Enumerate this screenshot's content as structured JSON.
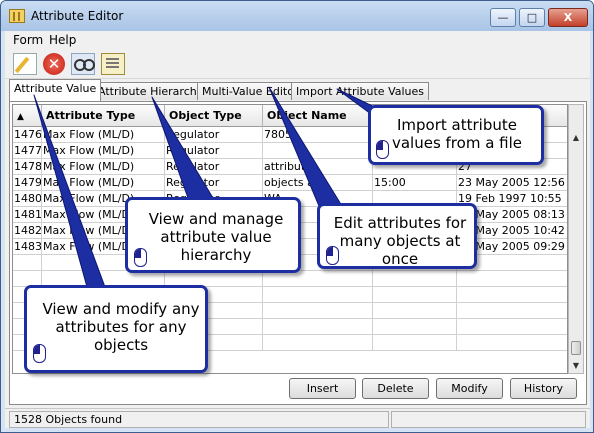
{
  "window": {
    "title": "Attribute Editor",
    "min_glyph": "—",
    "max_glyph": "□",
    "close_glyph": "X"
  },
  "menu": [
    "Form",
    "Help"
  ],
  "toolbar": {
    "icons": [
      "edit-icon",
      "delete-icon",
      "find-icon",
      "list-icon"
    ],
    "delete_glyph": "✕"
  },
  "tabs": [
    "Attribute Value",
    "Attribute Hierarchy",
    "Multi-Value Editor",
    "Import Attribute Values"
  ],
  "grid": {
    "sort_glyph": "▲",
    "columns": [
      "",
      "Attribute Type",
      "Object Type",
      "Object Name",
      "",
      ""
    ],
    "rows": [
      [
        "1476",
        "Max Flow (ML/D)",
        "Regulator",
        "7805",
        "",
        "05:39"
      ],
      [
        "1477",
        "Max Flow (ML/D)",
        "Regulator",
        "",
        "",
        "00"
      ],
      [
        "1478",
        "Max Flow (ML/D)",
        "Regulator",
        "attributes",
        "",
        "27"
      ],
      [
        "1479",
        "Max Flow (ML/D)",
        "Regulator",
        "objects at",
        "15:00",
        "23 May 2005 12:56"
      ],
      [
        "1480",
        "Max Flow (ML/D)",
        "Regulator",
        "WA",
        "",
        "19 Feb 1997 10:55"
      ],
      [
        "1481",
        "Max Flow (ML/D)",
        "Regulator",
        "",
        "",
        "23 May 2005 08:13"
      ],
      [
        "1482",
        "Max Flow (ML/D)",
        "Regulator",
        "",
        "",
        "23 May 2005 10:42"
      ],
      [
        "1483",
        "Max Flow (ML/D)",
        "Regulator",
        "A",
        "",
        "23 May 2005 09:29"
      ]
    ],
    "empty_rows": 6
  },
  "buttons": [
    "Insert",
    "Delete",
    "Modify",
    "History"
  ],
  "status": {
    "text": "1528 Objects found"
  },
  "callouts": {
    "import": "Import attribute values from a file",
    "hierarchy": "View and manage attribute value hierarchy",
    "multi": "Edit attributes for many objects at once",
    "value": "View and modify any attributes for any objects"
  },
  "colors": {
    "callout_border": "#1c2ea2",
    "titlebar": "#b8cfec",
    "window_face": "#f0f0f0"
  }
}
